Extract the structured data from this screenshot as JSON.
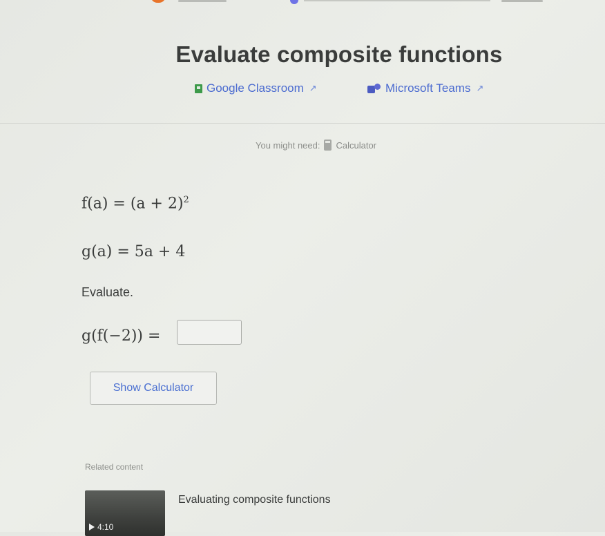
{
  "header": {
    "title": "Evaluate composite functions"
  },
  "share": {
    "google_classroom": "Google Classroom",
    "microsoft_teams": "Microsoft Teams"
  },
  "hint": {
    "prefix": "You might need:",
    "tool": "Calculator"
  },
  "problem": {
    "f_def": "f(a) = (a + 2)",
    "f_exp": "2",
    "g_def": "g(a) = 5a + 4",
    "instruction": "Evaluate.",
    "question": "g(f(−2)) =",
    "answer_value": ""
  },
  "actions": {
    "show_calculator": "Show Calculator"
  },
  "related": {
    "label": "Related content",
    "video_title": "Evaluating composite functions",
    "video_duration": "4:10"
  },
  "colors": {
    "link_blue": "#4b6bd0",
    "google_green": "#3d9a4a",
    "teams_purple": "#4c5bc1",
    "accent_orange": "#e8742a"
  }
}
